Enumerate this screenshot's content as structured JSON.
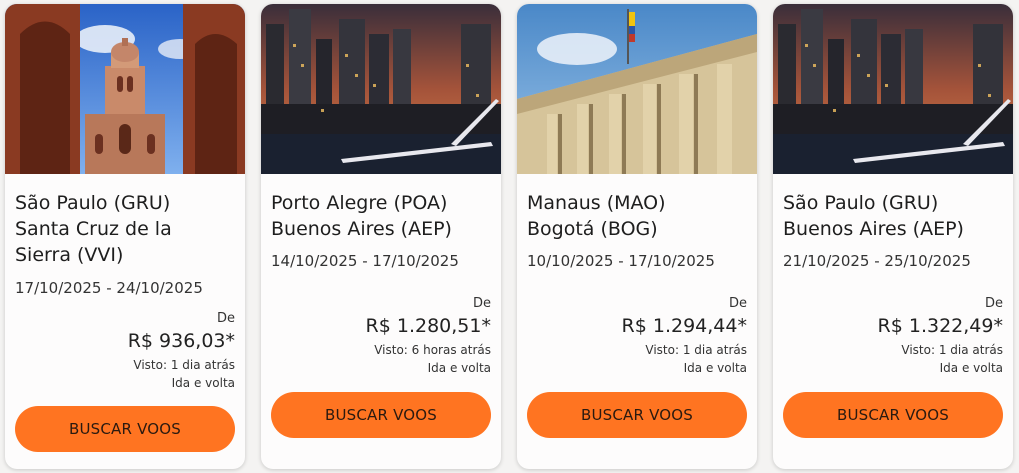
{
  "accent_color": "#ff7421",
  "cards": [
    {
      "origin": "São Paulo (GRU)",
      "destination_line1": "Santa Cruz de la",
      "destination_line2": "Sierra (VVI)",
      "dates": "17/10/2025 - 24/10/2025",
      "from_label": "De",
      "price": "R$ 936,03*",
      "seen": "Visto: 1 dia atrás",
      "trip_type": "Ida e volta",
      "button": "BUSCAR VOOS",
      "image": "church-tower-photo"
    },
    {
      "origin": "Porto Alegre (POA)",
      "destination": "Buenos Aires (AEP)",
      "dates": "14/10/2025 - 17/10/2025",
      "from_label": "De",
      "price": "R$ 1.280,51*",
      "seen": "Visto: 6 horas atrás",
      "trip_type": "Ida e volta",
      "button": "BUSCAR VOOS",
      "image": "city-skyline-photo"
    },
    {
      "origin": "Manaus (MAO)",
      "destination": "Bogotá (BOG)",
      "dates": "10/10/2025 - 17/10/2025",
      "from_label": "De",
      "price": "R$ 1.294,44*",
      "seen": "Visto: 1 dia atrás",
      "trip_type": "Ida e volta",
      "button": "BUSCAR VOOS",
      "image": "capitol-building-photo"
    },
    {
      "origin": "São Paulo (GRU)",
      "destination": "Buenos Aires (AEP)",
      "dates": "21/10/2025 - 25/10/2025",
      "from_label": "De",
      "price": "R$ 1.322,49*",
      "seen": "Visto: 1 dia atrás",
      "trip_type": "Ida e volta",
      "button": "BUSCAR VOOS",
      "image": "city-skyline-photo"
    }
  ]
}
